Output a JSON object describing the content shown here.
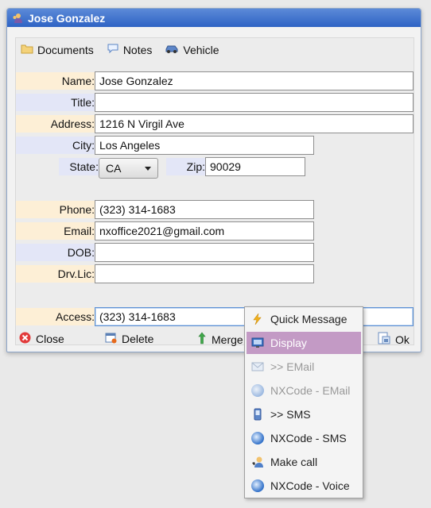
{
  "window": {
    "title": "Jose Gonzalez"
  },
  "tabs": [
    {
      "label": "Documents",
      "icon": "folder-icon"
    },
    {
      "label": "Notes",
      "icon": "speech-bubble-icon"
    },
    {
      "label": "Vehicle",
      "icon": "car-icon"
    }
  ],
  "fields": {
    "name": {
      "label": "Name:",
      "value": "Jose Gonzalez"
    },
    "title": {
      "label": "Title:",
      "value": ""
    },
    "address": {
      "label": "Address:",
      "value": "1216 N Virgil Ave"
    },
    "city": {
      "label": "City:",
      "value": "Los Angeles"
    },
    "state": {
      "label": "State:",
      "value": "CA"
    },
    "zip": {
      "label": "Zip:",
      "value": "90029"
    },
    "phone": {
      "label": "Phone:",
      "value": "(323) 314-1683"
    },
    "email": {
      "label": "Email:",
      "value": "nxoffice2021@gmail.com"
    },
    "dob": {
      "label": "DOB:",
      "value": ""
    },
    "drvlic": {
      "label": "Drv.Lic:",
      "value": ""
    },
    "access": {
      "label": "Access:",
      "value": "(323) 314-1683"
    }
  },
  "buttons": {
    "close": "Close",
    "delete": "Delete",
    "merge": "Merge",
    "ok": "Ok"
  },
  "context_menu": {
    "items": [
      {
        "label": "Quick Message",
        "icon": "lightning-icon",
        "enabled": true,
        "selected": false
      },
      {
        "label": "Display",
        "icon": "monitor-icon",
        "enabled": true,
        "selected": true
      },
      {
        "label": ">> EMail",
        "icon": "envelope-icon",
        "enabled": false,
        "selected": false
      },
      {
        "label": "NXCode - EMail",
        "icon": "nxcode-icon",
        "enabled": false,
        "selected": false
      },
      {
        "label": ">> SMS",
        "icon": "mobile-phone-icon",
        "enabled": true,
        "selected": false
      },
      {
        "label": "NXCode - SMS",
        "icon": "nxcode-icon",
        "enabled": true,
        "selected": false
      },
      {
        "label": "Make call",
        "icon": "phone-call-icon",
        "enabled": true,
        "selected": false
      },
      {
        "label": "NXCode - Voice",
        "icon": "nxcode-icon",
        "enabled": true,
        "selected": false
      }
    ]
  },
  "colors": {
    "title_bar": "#2e63c4",
    "label_orange": "#fdefd6",
    "label_blue": "#e3e6f7",
    "menu_selected": "#c39ac5"
  }
}
